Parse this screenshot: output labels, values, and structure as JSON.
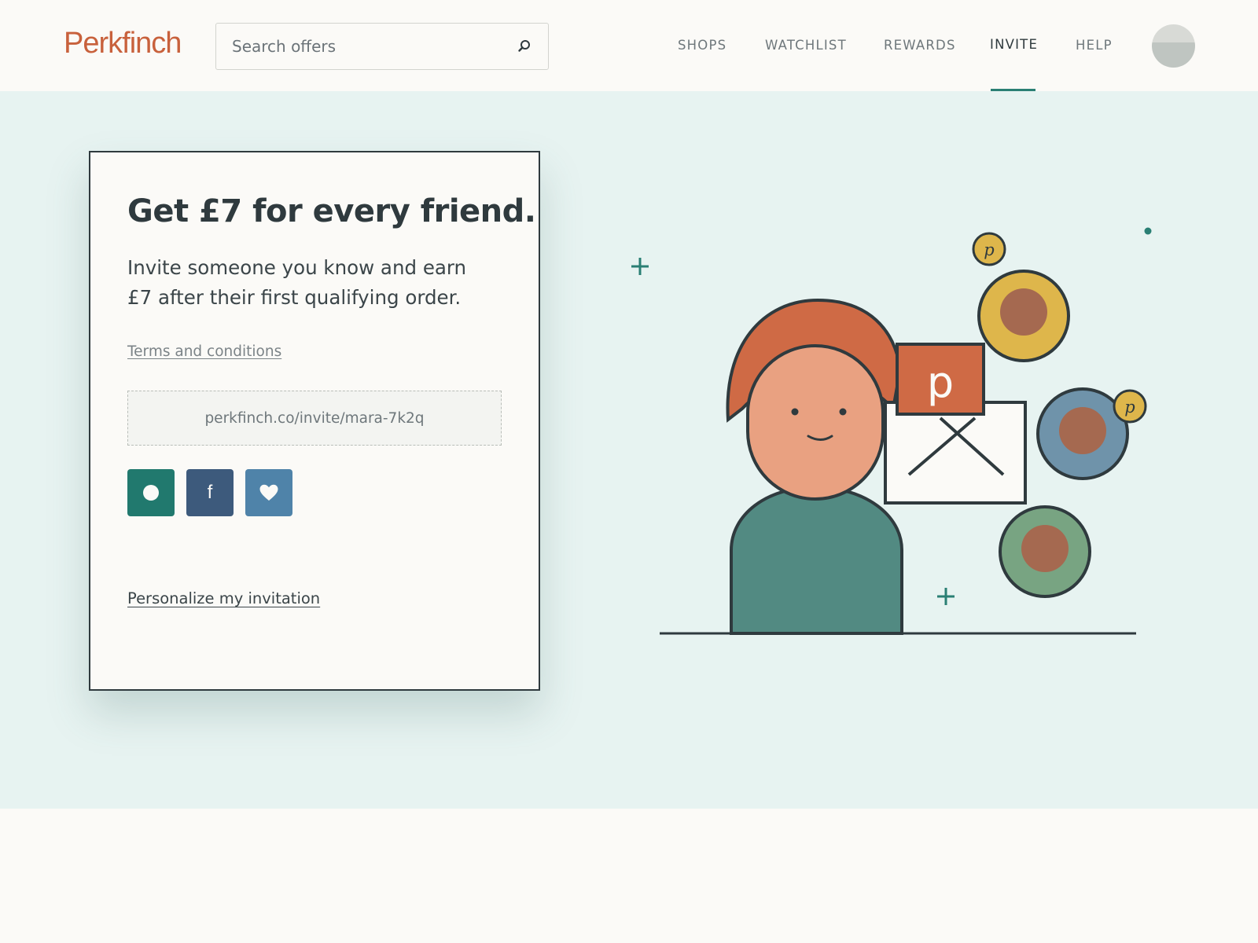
{
  "header": {
    "logo": "Perkfinch",
    "search": {
      "placeholder": "Search offers",
      "value": "",
      "icon": "search-icon"
    },
    "nav": [
      {
        "label": "SHOPS",
        "active": false
      },
      {
        "label": "WATCHLIST",
        "active": false
      },
      {
        "label": "REWARDS",
        "active": false
      },
      {
        "label": "INVITE",
        "active": true
      },
      {
        "label": "HELP",
        "active": false
      }
    ],
    "avatar_icon": "user-avatar"
  },
  "invite_card": {
    "title": "Get £7 for every friend.",
    "body": "Invite someone you know and earn £7 after their first qualifying order.",
    "terms_link": "Terms and conditions",
    "invite_url": "perkfinch.co/invite/mara-7k2q",
    "share_buttons": [
      {
        "icon": "dot-icon",
        "color": "#21796e"
      },
      {
        "icon": "facebook-icon",
        "label": "f",
        "color": "#3d5a7c"
      },
      {
        "icon": "heart-icon",
        "color": "#4f83a9"
      }
    ],
    "personalize_link": "Personalize my invitation"
  },
  "illustration": {
    "badge_letter": "p",
    "coin_letter": "p"
  },
  "colors": {
    "brand": "#c8613c",
    "accent": "#2a7f74",
    "hero_background": "#e7f3f1",
    "page_background": "#fbfaf7",
    "ink": "#2f3a3e"
  }
}
